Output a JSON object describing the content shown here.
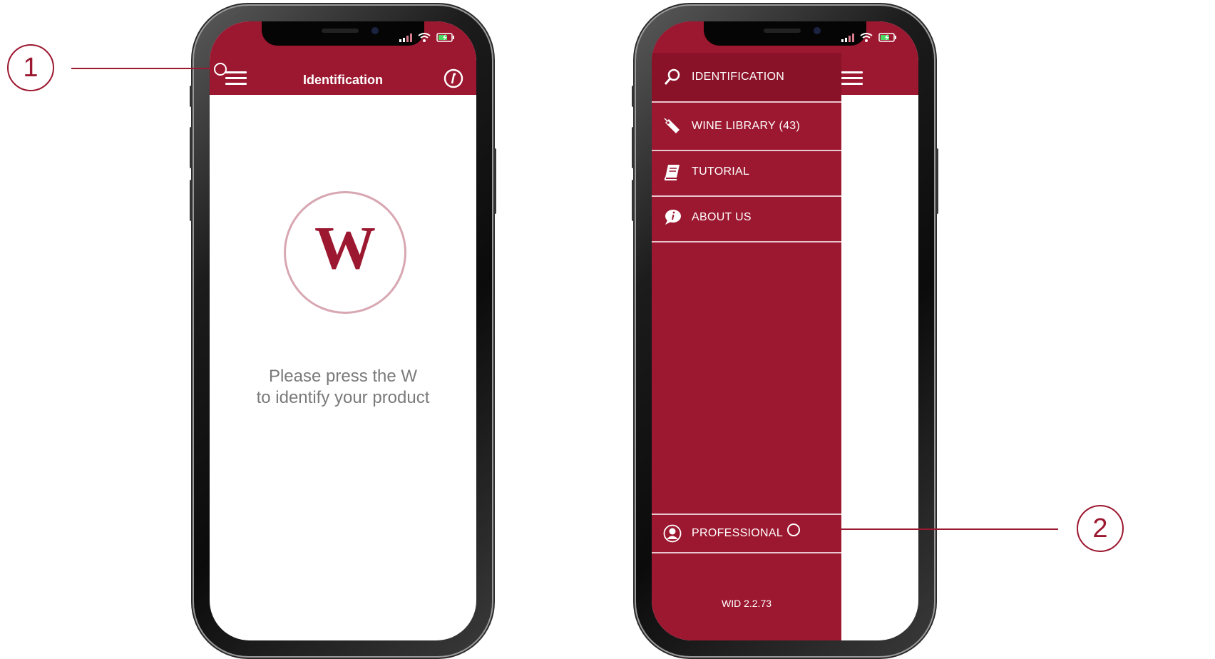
{
  "brand": {
    "accent": "#9c1830",
    "light": "#d8a7b2"
  },
  "left_phone": {
    "header": {
      "title": "Identification"
    },
    "logo_letter": "W",
    "hint_line1": "Please press the W",
    "hint_line2": "to identify your product"
  },
  "right_phone": {
    "menu": [
      {
        "label": "IDENTIFICATION",
        "icon": "search-icon"
      },
      {
        "label": "WINE LIBRARY (43)",
        "icon": "tag-icon"
      },
      {
        "label": "TUTORIAL",
        "icon": "book-icon"
      },
      {
        "label": "ABOUT US",
        "icon": "info-bubble-icon"
      }
    ],
    "professional": {
      "label": "PROFESSIONAL",
      "icon": "user-icon"
    },
    "version": "WID 2.2.73"
  },
  "annotations": [
    "1",
    "2"
  ]
}
